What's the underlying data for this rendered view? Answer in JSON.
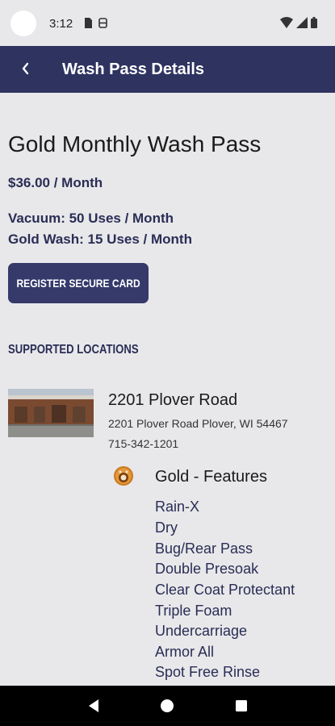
{
  "status_bar": {
    "time": "3:12"
  },
  "app_bar": {
    "title": "Wash Pass Details"
  },
  "pass": {
    "title": "Gold Monthly Wash Pass",
    "price": "$36.00 / Month",
    "usage": [
      "Vacuum: 50 Uses / Month",
      "Gold Wash: 15 Uses / Month"
    ],
    "register_button": "REGISTER SECURE CARD"
  },
  "locations": {
    "header": "SUPPORTED LOCATIONS",
    "items": [
      {
        "name": "2201 Plover Road",
        "address": "2201 Plover Road Plover, WI 54467",
        "phone": "715-342-1201",
        "features_title": "Gold - Features",
        "features": [
          "Rain-X",
          "Dry",
          "Bug/Rear Pass",
          "Double Presoak",
          "Clear Coat Protectant",
          "Triple Foam",
          "Undercarriage",
          "Armor All",
          "Spot Free Rinse"
        ]
      }
    ]
  },
  "colors": {
    "app_bar": "#2f3360",
    "accent_text": "#2a2d55",
    "button": "#353a6b",
    "background": "#e8e8ea",
    "gold": "#c97a1e"
  },
  "icons": {
    "back": "chevron-left-icon",
    "gold_badge": "gold-badge-icon",
    "nav_back": "triangle-back-icon",
    "nav_home": "circle-home-icon",
    "nav_recents": "square-recents-icon"
  }
}
